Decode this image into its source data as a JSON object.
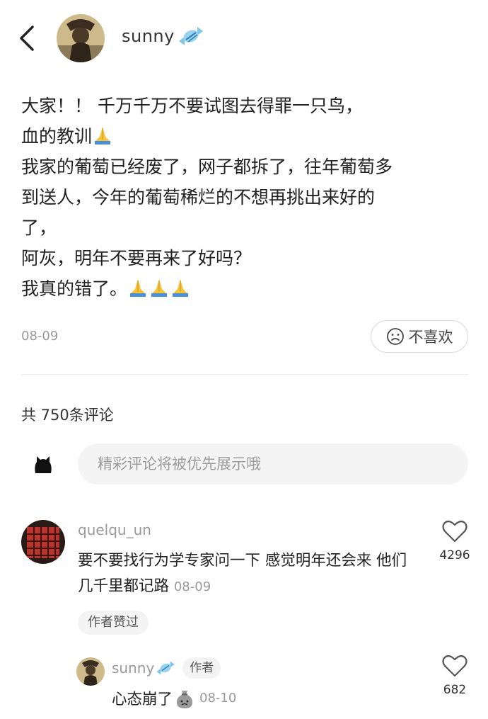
{
  "header": {
    "username": "sunny"
  },
  "post": {
    "lines": [
      "大家！！ 千万千万不要试图去得罪一只鸟，",
      "血的教训",
      "我家的葡萄已经废了，网子都拆了，往年葡萄多",
      "到送人，今年的葡萄稀烂的不想再挑出来好的",
      "了，",
      "阿灰，明年不要再来了好吗？",
      "我真的错了。"
    ],
    "date": "08-09",
    "dislike_label": "不喜欢"
  },
  "comments_header": {
    "count_text": "共 750条评论"
  },
  "composer": {
    "placeholder": "精彩评论将被优先展示哦"
  },
  "comments": [
    {
      "username": "quelqu_un",
      "text": "要不要找行为学专家问一下 感觉明年还会来 他们几千里都记路",
      "date": "08-09",
      "likes": "4296",
      "badge": "作者赞过"
    }
  ],
  "reply": {
    "username": "sunny",
    "tag": "作者",
    "text": "心态崩了",
    "date": "08-10",
    "likes": "682"
  },
  "colors": {
    "text": "#222222",
    "muted": "#9a9a9a",
    "pill_bg": "#f4f4f4",
    "divider": "#eeeeee"
  }
}
